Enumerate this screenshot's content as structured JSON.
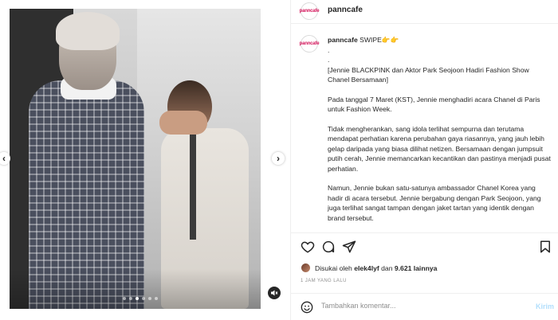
{
  "account": {
    "username": "panncafe",
    "avatar_text": "panncafe"
  },
  "caption": {
    "username": "panncafe",
    "lead": "SWIPE👉👉",
    "dot1": ".",
    "dot2": ".",
    "title": "[Jennie BLACKPINK dan Aktor Park Seojoon Hadiri Fashion Show Chanel Bersamaan]",
    "para1": "Pada tanggal 7 Maret (KST), Jennie menghadiri acara Chanel di Paris untuk Fashion Week.",
    "para2": "Tidak mengherankan, sang idola terlihat sempurna dan terutama mendapat perhatian karena perubahan gaya riasannya, yang jauh lebih gelap daripada yang biasa dilihat netizen. Bersamaan dengan jumpsuit putih cerah, Jennie memancarkan kecantikan dan pastinya menjadi pusat perhatian.",
    "para3": "Namun, Jennie bukan satu-satunya ambassador Chanel Korea yang hadir di acara tersebut. Jennie bergabung dengan Park Seojoon, yang juga terlihat sangat tampan dengan jaket tartan yang identik dengan brand tersebut."
  },
  "likes": {
    "prefix": "Disukai oleh",
    "user": "elek4lyf",
    "middle": "dan",
    "count": "9.621 lainnya"
  },
  "time_ago": "1 JAM YANG LALU",
  "comment": {
    "placeholder": "Tambahkan komentar...",
    "post_label": "Kirim"
  },
  "carousel": {
    "slides": 6,
    "active_index": 2
  },
  "icons": {
    "prev": "chevron-left-icon",
    "next": "chevron-right-icon",
    "mute": "speaker-muted-icon",
    "like": "heart-icon",
    "comment": "comment-bubble-icon",
    "share": "paper-plane-icon",
    "save": "bookmark-icon",
    "emoji": "smiley-icon"
  },
  "colors": {
    "post_button": "#b2dffc",
    "text": "#262626",
    "muted": "#8e8e8e"
  }
}
